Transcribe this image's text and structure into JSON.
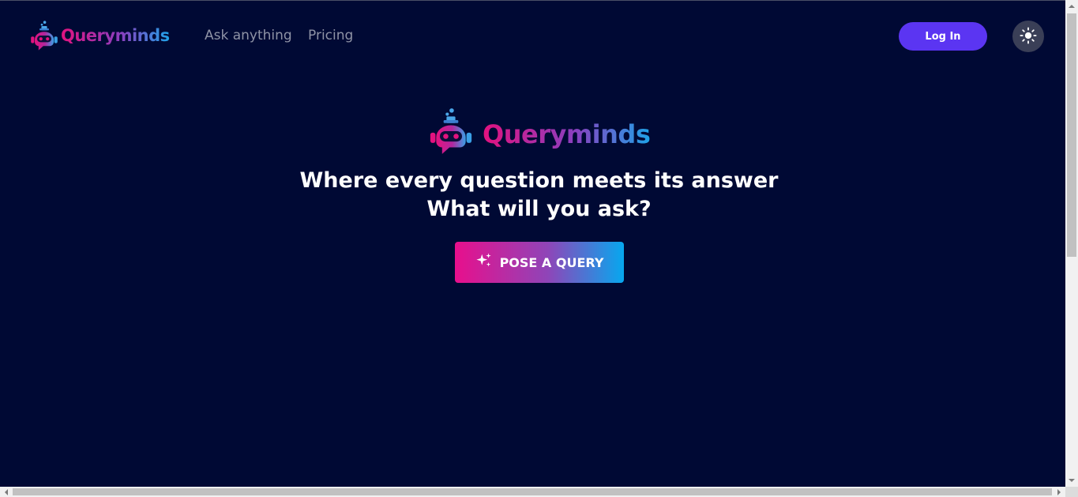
{
  "header": {
    "brand": "Queryminds",
    "nav": [
      {
        "label": "Ask anything"
      },
      {
        "label": "Pricing"
      }
    ],
    "login_label": "Log In",
    "theme_icon": "sun-icon"
  },
  "hero": {
    "brand": "Queryminds",
    "title_line1": "Where every question meets its answer",
    "title_line2": "What will you ask?",
    "cta_label": "POSE A QUERY",
    "cta_icon": "sparkles-icon"
  },
  "colors": {
    "background": "#000934",
    "brand_pink": "#e3127f",
    "brand_purple": "#8b3fbf",
    "brand_blue": "#1fa3e8",
    "login_button": "#5b35f2",
    "theme_button": "#3a3f57",
    "nav_link": "#8f93a6"
  }
}
